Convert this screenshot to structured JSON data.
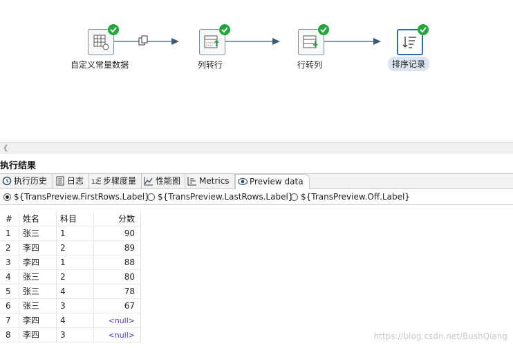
{
  "canvas": {
    "steps": [
      {
        "label": "自定义常量数据",
        "icon": "data-grid-icon",
        "status": "ok"
      },
      {
        "label": "列转行",
        "icon": "column-to-row-icon",
        "status": "ok"
      },
      {
        "label": "行转列",
        "icon": "row-to-column-icon",
        "status": "ok"
      },
      {
        "label": "排序记录",
        "icon": "sort-records-icon",
        "status": "ok",
        "selected": true
      }
    ],
    "hop_icon": "copy-rows-icon"
  },
  "results": {
    "title": "执行结果",
    "tabs": [
      {
        "label": "执行历史",
        "icon": "history-icon"
      },
      {
        "label": "日志",
        "icon": "log-icon"
      },
      {
        "label": "步骤度量",
        "icon": "step-metrics-icon"
      },
      {
        "label": "性能图",
        "icon": "performance-chart-icon"
      },
      {
        "label": "Metrics",
        "icon": "metrics-icon"
      },
      {
        "label": "Preview data",
        "icon": "eye-icon",
        "active": true
      }
    ],
    "preview_options": [
      {
        "label": "${TransPreview.FirstRows.Label}",
        "selected": true
      },
      {
        "label": "${TransPreview.LastRows.Label}",
        "selected": false
      },
      {
        "label": "${TransPreview.Off.Label}",
        "selected": false
      }
    ],
    "table": {
      "headers": [
        "#",
        "姓名",
        "科目",
        "分数"
      ],
      "rows": [
        [
          "1",
          "张三",
          "1",
          "90"
        ],
        [
          "2",
          "李四",
          "2",
          "89"
        ],
        [
          "3",
          "李四",
          "1",
          "88"
        ],
        [
          "4",
          "张三",
          "2",
          "80"
        ],
        [
          "5",
          "张三",
          "4",
          "78"
        ],
        [
          "6",
          "张三",
          "3",
          "67"
        ],
        [
          "7",
          "李四",
          "4",
          "<null>"
        ],
        [
          "8",
          "李四",
          "3",
          "<null>"
        ]
      ]
    }
  },
  "watermark": "https://blog.csdn.net/BushQiang"
}
